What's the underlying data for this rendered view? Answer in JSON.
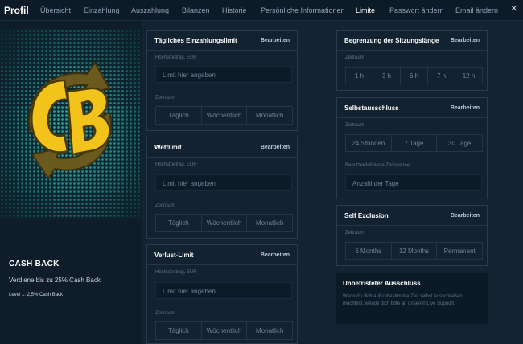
{
  "header": {
    "title": "Profil",
    "nav": [
      {
        "label": "Übersicht",
        "active": false
      },
      {
        "label": "Einzahlung",
        "active": false
      },
      {
        "label": "Auszahlung",
        "active": false
      },
      {
        "label": "Bilanzen",
        "active": false
      },
      {
        "label": "Historie",
        "active": false
      },
      {
        "label": "Persönliche Informationen",
        "active": false
      },
      {
        "label": "Limite",
        "active": true
      },
      {
        "label": "Passwort ändern",
        "active": false
      },
      {
        "label": "Email ändern",
        "active": false
      }
    ],
    "close_icon": "×"
  },
  "promo": {
    "logo_text": "CB",
    "title": "CASH BACK",
    "subtitle": "Verdiene bis zu 25% Cash Back",
    "level": "Level 1: 2,5% Cash Back",
    "colors": {
      "logo": "#f2c31a",
      "arrow": "#6b5a1e",
      "dots": "#2c9b8c"
    }
  },
  "cards": {
    "deposit": {
      "title": "Tägliches Einzahlungslimit",
      "edit": "Bearbeiten",
      "amount_label": "Höchstbetrag, EUR",
      "amount_placeholder": "Limit hier angeben",
      "period_label": "Zeitraum",
      "periods": [
        "Täglich",
        "Wöchentlich",
        "Monatlich"
      ]
    },
    "bet": {
      "title": "Wettlimit",
      "edit": "Bearbeiten",
      "amount_label": "Höchstbetrag, EUR",
      "amount_placeholder": "Limit hier angeben",
      "period_label": "Zeitraum",
      "periods": [
        "Täglich",
        "Wöchentlich",
        "Monatlich"
      ]
    },
    "loss": {
      "title": "Verlust-Limit",
      "edit": "Bearbeiten",
      "amount_label": "Höchstbetrag, EUR",
      "amount_placeholder": "Limit hier angeben",
      "period_label": "Zeitraum",
      "periods": [
        "Täglich",
        "Wöchentlich",
        "Monatlich"
      ]
    },
    "session": {
      "title": "Begrenzung der Sitzungslänge",
      "edit": "Bearbeiten",
      "period_label": "Zeitraum",
      "options": [
        "1 h",
        "3 h",
        "6 h",
        "7 h",
        "12 h"
      ]
    },
    "self_exclusion_de": {
      "title": "Selbstausschluss",
      "edit": "Bearbeiten",
      "period_label": "Zeitraum",
      "options": [
        "24 Stunden",
        "7 Tage",
        "30 Tage"
      ],
      "custom_label": "Benutzerdefinierte Zeitspanne",
      "custom_placeholder": "Anzahl der Tage"
    },
    "self_exclusion_en": {
      "title": "Self Exclusion",
      "edit": "Bearbeiten",
      "period_label": "Zeitraum",
      "options": [
        "6 Months",
        "12 Months",
        "Permanent"
      ]
    },
    "unlimited": {
      "title": "Unbefristeter Ausschluss",
      "text": "Wenn du dich auf unbestimmte Zeit selbst ausschließen möchtest, wende dich bitte an unseren Live Support."
    }
  }
}
